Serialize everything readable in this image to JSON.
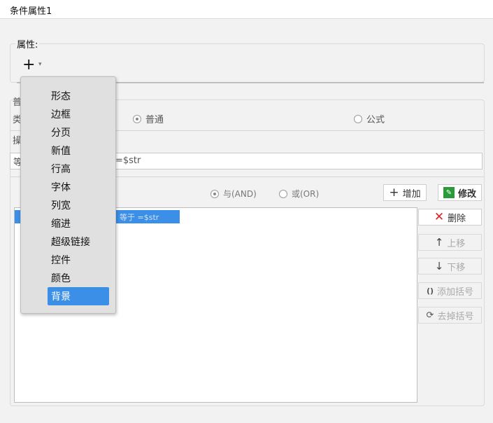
{
  "window": {
    "title": "条件属性1"
  },
  "attr_section": {
    "label": "属性:",
    "add_symbol": "+",
    "add_arrow": "▾"
  },
  "cond_section": {
    "clipped_labels": [
      "普",
      "类",
      "操",
      "等"
    ],
    "type_radios": [
      {
        "label": "普通",
        "checked": true
      },
      {
        "label": "公式",
        "checked": false
      }
    ],
    "expression": "=$str",
    "logic_radios": [
      {
        "label": "与(AND)",
        "checked": true
      },
      {
        "label": "或(OR)",
        "checked": false
      }
    ],
    "buttons": {
      "add": "增加",
      "modify": "修改",
      "delete": "删除",
      "up": "上移",
      "down": "下移",
      "add_paren": "添加括号",
      "remove_paren": "去掉括号"
    },
    "icons": {
      "add": "+",
      "delete": "✕",
      "up": "↑",
      "down": "↓",
      "add_paren": "()",
      "remove_paren": "⟳",
      "modify": "✎"
    },
    "list_rows": [
      "等于 =$str"
    ]
  },
  "dropdown_menu": {
    "items": [
      "形态",
      "边框",
      "分页",
      "新值",
      "行高",
      "字体",
      "列宽",
      "缩进",
      "超级链接",
      "控件",
      "颜色",
      "背景"
    ],
    "active_index": 11
  },
  "colors": {
    "accent": "#3c8fe6",
    "delete_red": "#e02020",
    "modify_green": "#2a9a3a"
  }
}
